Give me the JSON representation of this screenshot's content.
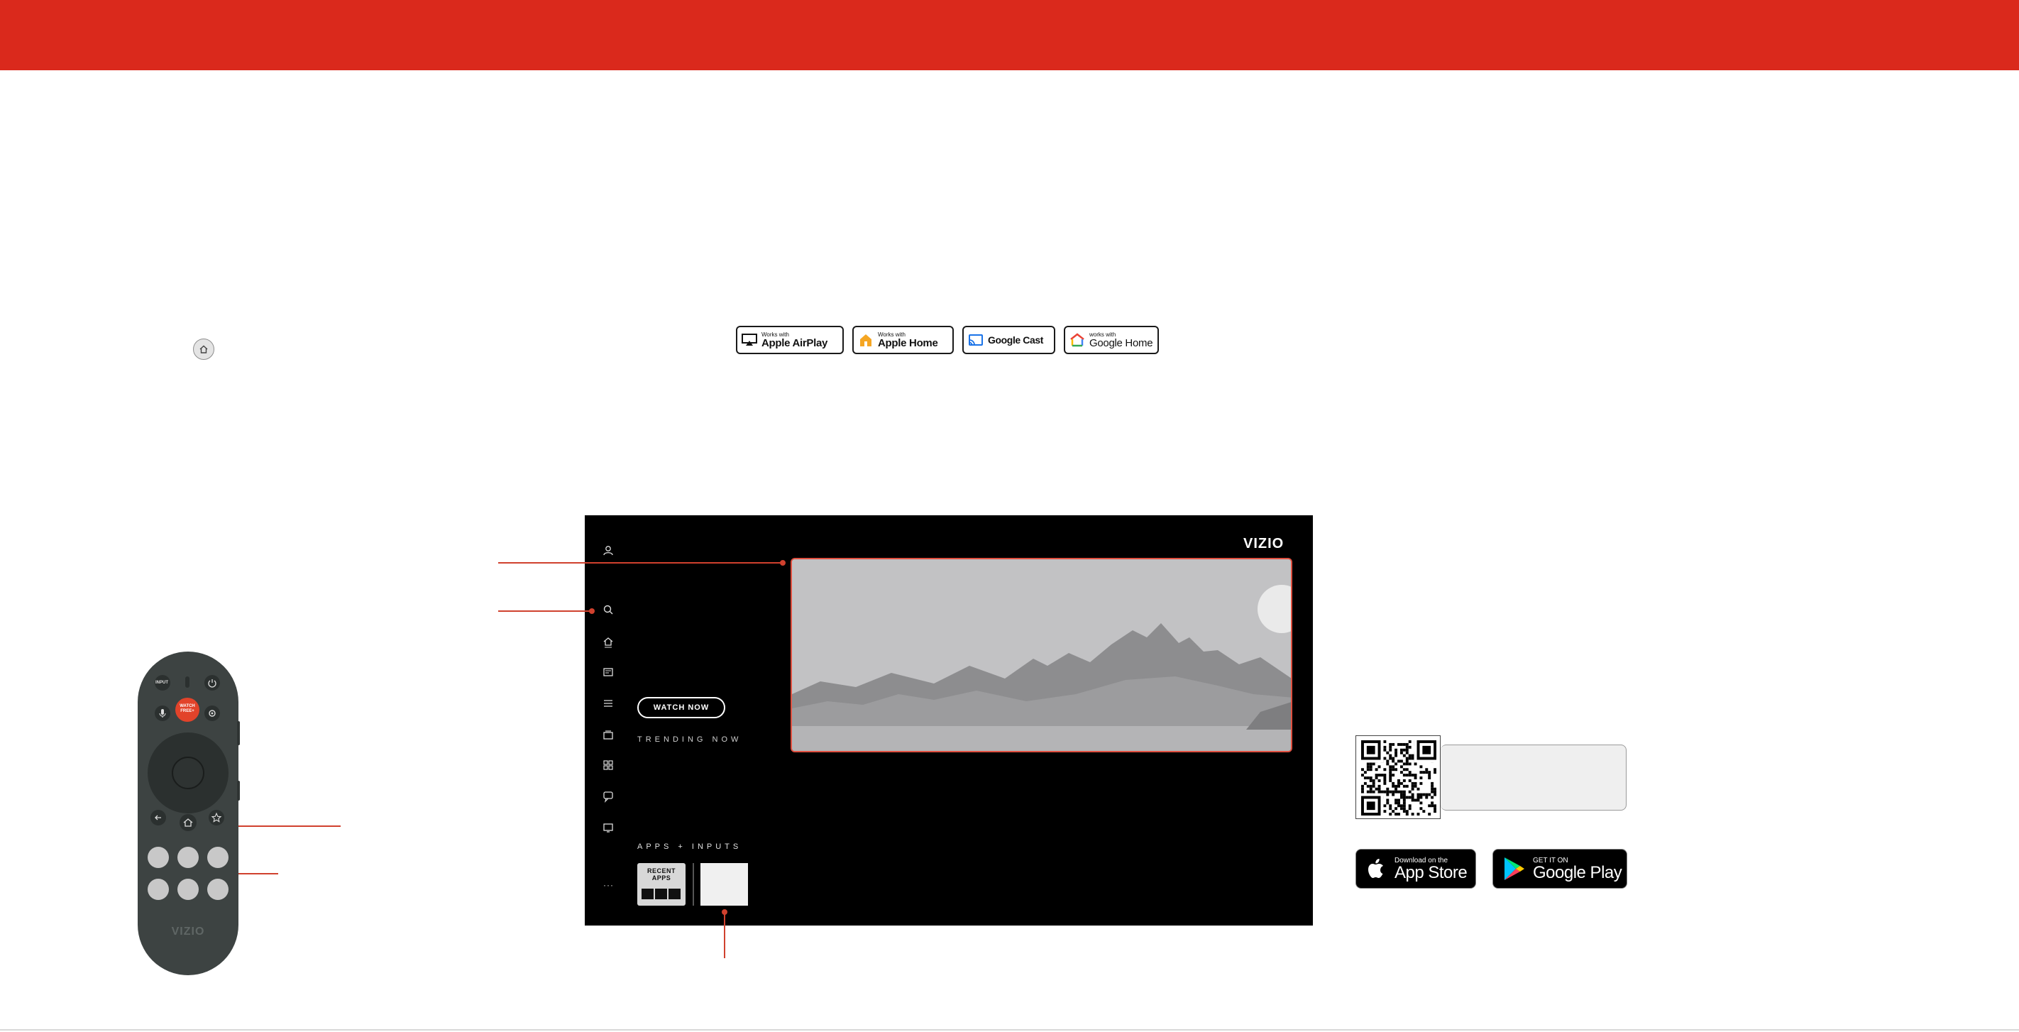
{
  "colors": {
    "brand_red": "#da291c",
    "callout": "#d0412e",
    "tv_bg": "#000000",
    "remote_body": "#3d4342"
  },
  "badges": {
    "airplay": {
      "small": "Works with",
      "big": "Apple AirPlay",
      "icon": "airplay-icon"
    },
    "apple_home": {
      "small": "Works with",
      "big": "Apple Home",
      "icon": "home-icon"
    },
    "google_cast": {
      "label": "Google Cast",
      "icon": "cast-icon"
    },
    "google_home": {
      "small": "works with",
      "big": "Google Home",
      "icon": "google-home-icon"
    }
  },
  "tv": {
    "brand": "VIZIO",
    "watch_now": "WATCH NOW",
    "trending": "TRENDING NOW",
    "apps_inputs": "APPS + INPUTS",
    "recent_apps": "RECENT APPS",
    "more": "···",
    "side_icons": [
      "profile-icon",
      "search-icon",
      "home-icon",
      "guide-icon",
      "menu-icon",
      "live-tv-icon",
      "apps-icon",
      "chat-icon",
      "cast-icon"
    ]
  },
  "remote": {
    "input": "INPUT",
    "watchfree_line1": "WATCH",
    "watchfree_line2": "FREE+",
    "brand": "VIZIO"
  },
  "stores": {
    "apple": {
      "line1": "Download on the",
      "line2": "App Store"
    },
    "google": {
      "line1": "GET IT ON",
      "line2": "Google Play"
    }
  }
}
